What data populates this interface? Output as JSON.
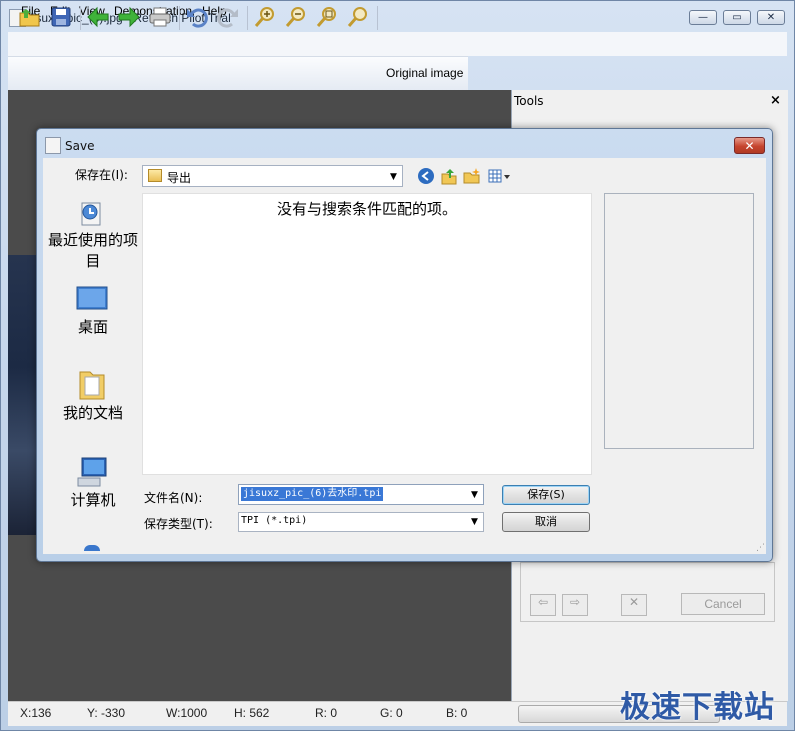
{
  "window": {
    "title": "jisuxz_pic_(6).jpg - Retouch Pilot Trial",
    "minimize_glyph": "—",
    "maximize_glyph": "▭",
    "close_glyph": "✕"
  },
  "menu": [
    "File",
    "Edit",
    "View",
    "Demonstration",
    "Help"
  ],
  "toolbar": {
    "icons": [
      "open-icon",
      "save-icon",
      "back-arrow-icon",
      "forward-arrow-icon",
      "print-icon",
      "undo-icon",
      "redo-icon",
      "zoom-in-icon",
      "zoom-out-icon",
      "zoom-fit-icon",
      "zoom-actual-icon"
    ],
    "original_image_label": "Original image"
  },
  "tools_panel": {
    "title": "Tools",
    "close_glyph": "×",
    "cancel_label": "Cancel"
  },
  "status": {
    "x": "X:136",
    "y": "Y: -330",
    "w": "W:1000",
    "h": "H: 562",
    "r": "R: 0",
    "g": "G: 0",
    "b": "B: 0"
  },
  "watermark": "极速下载站",
  "dialog": {
    "title": "Save",
    "close_glyph": "✕",
    "save_in_label": "保存在(I):",
    "save_in_value": "导出",
    "places": [
      {
        "label": "最近使用的项目",
        "icon": "recent-items-icon"
      },
      {
        "label": "桌面",
        "icon": "desktop-icon"
      },
      {
        "label": "我的文档",
        "icon": "documents-icon"
      },
      {
        "label": "计算机",
        "icon": "computer-icon"
      }
    ],
    "no_match_text": "没有与搜索条件匹配的项。",
    "file_name_label": "文件名(N):",
    "file_name_value": "jisuxz_pic_(6)去水印.tpi",
    "file_type_label": "保存类型(T):",
    "file_type_value": "TPI (*.tpi)",
    "save_button": "保存(S)",
    "cancel_button": "取消"
  },
  "colors": {
    "accent": "#3a78d6",
    "workspace": "#4b4b4b",
    "watermark": "#2f5aa6"
  }
}
